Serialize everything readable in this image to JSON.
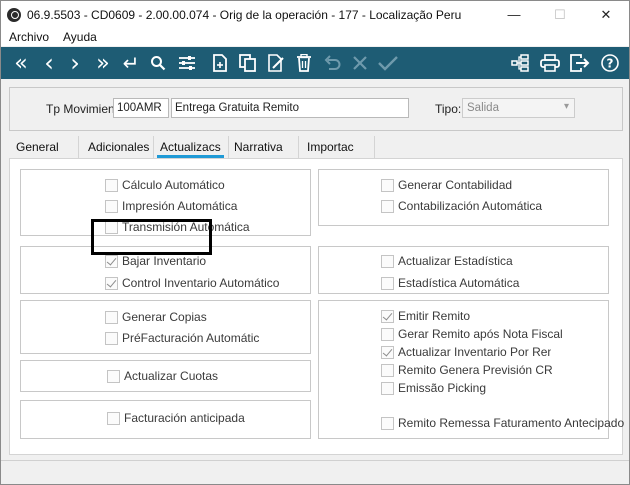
{
  "window": {
    "title": "06.9.5503 - CD0609 - 2.00.00.074 - Orig de la operación - 177 - Localização Peru",
    "controls": {
      "minimize": "—",
      "maximize": "☐",
      "close": "✕"
    }
  },
  "menu": [
    "Archivo",
    "Ayuda"
  ],
  "toolbar": {
    "buttons": [
      {
        "icon": "first-record-icon",
        "glyph": "«"
      },
      {
        "icon": "previous-record-icon",
        "glyph": "‹"
      },
      {
        "icon": "next-record-icon",
        "glyph": "›"
      },
      {
        "icon": "last-record-icon",
        "glyph": "»"
      },
      {
        "icon": "return-icon",
        "glyph": "↵"
      },
      {
        "icon": "search-icon"
      },
      {
        "icon": "filter-sliders-icon"
      },
      {
        "icon": "new-document-icon"
      },
      {
        "icon": "copy-icon"
      },
      {
        "icon": "edit-icon"
      },
      {
        "icon": "delete-icon"
      },
      {
        "icon": "undo-icon"
      },
      {
        "icon": "cancel-icon"
      },
      {
        "icon": "confirm-icon"
      },
      {
        "icon": "tree-icon"
      },
      {
        "icon": "print-icon"
      },
      {
        "icon": "exit-icon"
      },
      {
        "icon": "help-icon"
      }
    ],
    "color": "#1e5c74"
  },
  "header": {
    "tp_movimien_label": "Tp Movimien:",
    "tp_movimien_code": "100AMR",
    "tp_movimien_desc": "Entrega Gratuita Remito",
    "tipo_label": "Tipo:",
    "tipo_value": "Salida"
  },
  "tabs": [
    {
      "label": "General",
      "active": false
    },
    {
      "label": "Adicionales",
      "active": false
    },
    {
      "label": "Actualizacs",
      "active": true
    },
    {
      "label": "Narrativa",
      "active": false
    },
    {
      "label": "Importac",
      "active": false
    }
  ],
  "accent_color": "#1f9ad6",
  "left_groups": [
    {
      "items": [
        {
          "label": "Cálculo Automático",
          "checked": false
        },
        {
          "label": "Impresión Automática",
          "checked": false
        },
        {
          "label": "Transmisión Automática",
          "checked": false
        }
      ]
    },
    {
      "items": [
        {
          "label": "Bajar Inventario",
          "checked": true
        },
        {
          "label": "Control Inventario Automático",
          "checked": true
        }
      ]
    },
    {
      "items": [
        {
          "label": "Generar Copias",
          "checked": false
        },
        {
          "label": "PréFacturación Automátic",
          "checked": false
        },
        {
          "label": "Actualizar Cuotas",
          "checked": false
        }
      ]
    },
    {
      "items": [
        {
          "label": "Facturación anticipada",
          "checked": false
        }
      ]
    }
  ],
  "right_groups": [
    {
      "items": [
        {
          "label": "Generar Contabilidad",
          "checked": false
        },
        {
          "label": "Contabilización Automática",
          "checked": false
        }
      ]
    },
    {
      "items": [
        {
          "label": "Actualizar Estadística",
          "checked": false
        },
        {
          "label": "Estadística Automática",
          "checked": false
        }
      ]
    },
    {
      "items": [
        {
          "label": "Emitir Remito",
          "checked": true
        },
        {
          "label": "Gerar Remito após Nota Fiscal",
          "checked": false
        },
        {
          "label": "Actualizar Inventario Por Remito",
          "checked": true
        },
        {
          "label": "Remito Genera Previsión CR",
          "checked": false
        },
        {
          "label": "Emissão Picking",
          "checked": false
        },
        {
          "label": "Remito Remessa Faturamento Antecipado",
          "checked": false
        }
      ]
    }
  ]
}
